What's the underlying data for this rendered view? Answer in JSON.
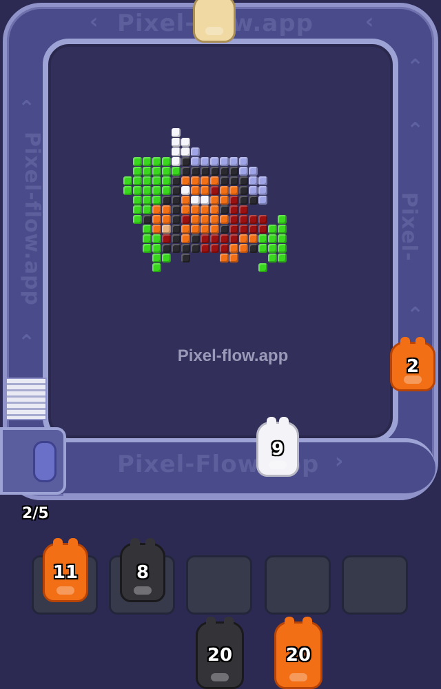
{
  "game": {
    "watermark": "Pixel-flow.app",
    "lane_watermark_top": "Pixel-flow.app",
    "lane_watermark_bottom": "Pixel-Flow.app",
    "lane_watermark_side": "Pixel-flow.app",
    "progress": "2/5",
    "belt_pigs": [
      {
        "color": "beige",
        "count": ""
      },
      {
        "color": "orange",
        "count": "2"
      },
      {
        "color": "white",
        "count": "9"
      }
    ],
    "queue_slots": [
      {
        "color": "orange",
        "count": "11"
      },
      {
        "color": "black",
        "count": "8"
      },
      {
        "color": "empty",
        "count": ""
      },
      {
        "color": "empty",
        "count": ""
      },
      {
        "color": "empty",
        "count": ""
      }
    ],
    "waiting_pigs": [
      {
        "color": "black",
        "count": "20"
      },
      {
        "color": "orange",
        "count": "20"
      }
    ],
    "palette": {
      "green": "#39d81e",
      "orange": "#f36f16",
      "dark_red": "#9b1111",
      "black": "#29292f",
      "white": "#f5f5fb",
      "lavender": "#9fa4e6",
      "tan": "#e8b17e"
    }
  }
}
